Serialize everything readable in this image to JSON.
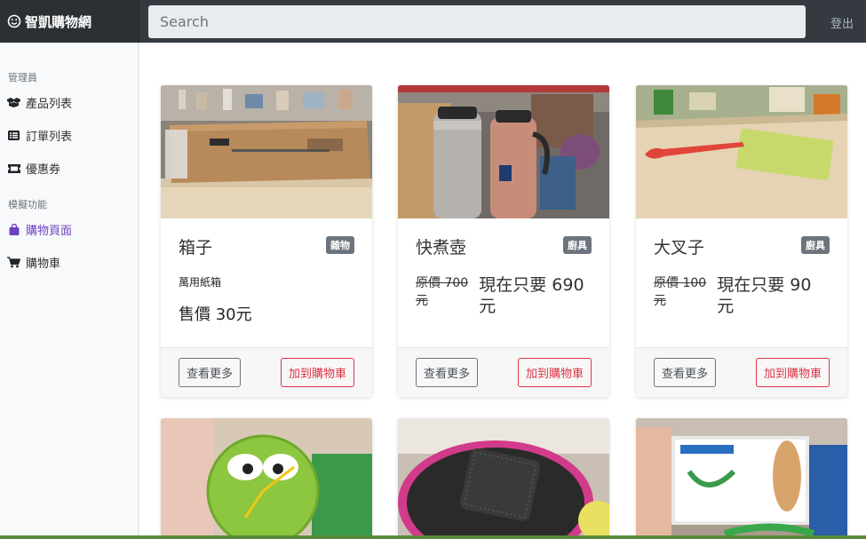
{
  "navbar": {
    "brand": "智凱購物網",
    "search_placeholder": "Search",
    "logout": "登出"
  },
  "sidebar": {
    "admin_heading": "管理員",
    "admin_items": [
      {
        "label": "產品列表",
        "icon": "boxes-icon"
      },
      {
        "label": "訂單列表",
        "icon": "list-icon"
      },
      {
        "label": "優惠券",
        "icon": "ticket-icon"
      }
    ],
    "sim_heading": "模擬功能",
    "sim_items": [
      {
        "label": "購物頁面",
        "icon": "shopping-bag-icon"
      },
      {
        "label": "購物車",
        "icon": "cart-icon"
      }
    ]
  },
  "products": [
    {
      "title": "箱子",
      "category": "雜物",
      "description": "萬用紙箱",
      "price_text": "售價 30元",
      "view_more": "查看更多",
      "add_to_cart": "加到購物車"
    },
    {
      "title": "快煮壺",
      "category": "廚具",
      "original_price": "原價 700 元",
      "current_price": "現在只要 690 元",
      "view_more": "查看更多",
      "add_to_cart": "加到購物車"
    },
    {
      "title": "大叉子",
      "category": "廚具",
      "original_price": "原價 100 元",
      "current_price": "現在只要 90 元",
      "view_more": "查看更多",
      "add_to_cart": "加到購物車"
    }
  ],
  "colors": {
    "navbar_bg": "#343a40",
    "sidebar_active": "#6f42c1",
    "badge_bg": "#6c757d",
    "danger": "#dc3545"
  }
}
